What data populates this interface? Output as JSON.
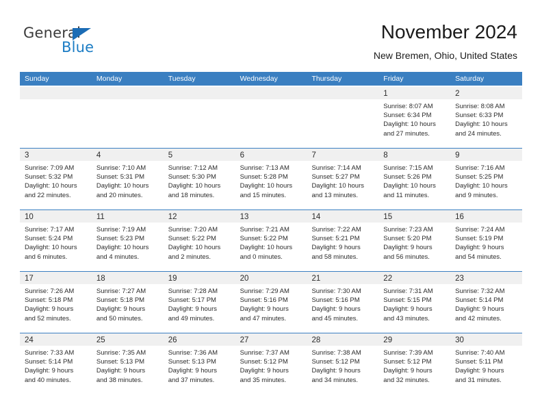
{
  "brand": {
    "name_top": "General",
    "name_bottom": "Blue",
    "triangle_color": "#1b6cb5",
    "blue_text_color": "#1b7cc4"
  },
  "header": {
    "title": "November 2024",
    "subtitle": "New Bremen, Ohio, United States"
  },
  "theme": {
    "header_blue": "#3a7fc1",
    "day_band_gray": "#f0f0f0",
    "text_color": "#2b2b2b"
  },
  "weekdays": [
    "Sunday",
    "Monday",
    "Tuesday",
    "Wednesday",
    "Thursday",
    "Friday",
    "Saturday"
  ],
  "weeks": [
    [
      {
        "empty": true
      },
      {
        "empty": true
      },
      {
        "empty": true
      },
      {
        "empty": true
      },
      {
        "empty": true
      },
      {
        "day": "1",
        "sunrise": "Sunrise: 8:07 AM",
        "sunset": "Sunset: 6:34 PM",
        "daylight1": "Daylight: 10 hours",
        "daylight2": "and 27 minutes."
      },
      {
        "day": "2",
        "sunrise": "Sunrise: 8:08 AM",
        "sunset": "Sunset: 6:33 PM",
        "daylight1": "Daylight: 10 hours",
        "daylight2": "and 24 minutes."
      }
    ],
    [
      {
        "day": "3",
        "sunrise": "Sunrise: 7:09 AM",
        "sunset": "Sunset: 5:32 PM",
        "daylight1": "Daylight: 10 hours",
        "daylight2": "and 22 minutes."
      },
      {
        "day": "4",
        "sunrise": "Sunrise: 7:10 AM",
        "sunset": "Sunset: 5:31 PM",
        "daylight1": "Daylight: 10 hours",
        "daylight2": "and 20 minutes."
      },
      {
        "day": "5",
        "sunrise": "Sunrise: 7:12 AM",
        "sunset": "Sunset: 5:30 PM",
        "daylight1": "Daylight: 10 hours",
        "daylight2": "and 18 minutes."
      },
      {
        "day": "6",
        "sunrise": "Sunrise: 7:13 AM",
        "sunset": "Sunset: 5:28 PM",
        "daylight1": "Daylight: 10 hours",
        "daylight2": "and 15 minutes."
      },
      {
        "day": "7",
        "sunrise": "Sunrise: 7:14 AM",
        "sunset": "Sunset: 5:27 PM",
        "daylight1": "Daylight: 10 hours",
        "daylight2": "and 13 minutes."
      },
      {
        "day": "8",
        "sunrise": "Sunrise: 7:15 AM",
        "sunset": "Sunset: 5:26 PM",
        "daylight1": "Daylight: 10 hours",
        "daylight2": "and 11 minutes."
      },
      {
        "day": "9",
        "sunrise": "Sunrise: 7:16 AM",
        "sunset": "Sunset: 5:25 PM",
        "daylight1": "Daylight: 10 hours",
        "daylight2": "and 9 minutes."
      }
    ],
    [
      {
        "day": "10",
        "sunrise": "Sunrise: 7:17 AM",
        "sunset": "Sunset: 5:24 PM",
        "daylight1": "Daylight: 10 hours",
        "daylight2": "and 6 minutes."
      },
      {
        "day": "11",
        "sunrise": "Sunrise: 7:19 AM",
        "sunset": "Sunset: 5:23 PM",
        "daylight1": "Daylight: 10 hours",
        "daylight2": "and 4 minutes."
      },
      {
        "day": "12",
        "sunrise": "Sunrise: 7:20 AM",
        "sunset": "Sunset: 5:22 PM",
        "daylight1": "Daylight: 10 hours",
        "daylight2": "and 2 minutes."
      },
      {
        "day": "13",
        "sunrise": "Sunrise: 7:21 AM",
        "sunset": "Sunset: 5:22 PM",
        "daylight1": "Daylight: 10 hours",
        "daylight2": "and 0 minutes."
      },
      {
        "day": "14",
        "sunrise": "Sunrise: 7:22 AM",
        "sunset": "Sunset: 5:21 PM",
        "daylight1": "Daylight: 9 hours",
        "daylight2": "and 58 minutes."
      },
      {
        "day": "15",
        "sunrise": "Sunrise: 7:23 AM",
        "sunset": "Sunset: 5:20 PM",
        "daylight1": "Daylight: 9 hours",
        "daylight2": "and 56 minutes."
      },
      {
        "day": "16",
        "sunrise": "Sunrise: 7:24 AM",
        "sunset": "Sunset: 5:19 PM",
        "daylight1": "Daylight: 9 hours",
        "daylight2": "and 54 minutes."
      }
    ],
    [
      {
        "day": "17",
        "sunrise": "Sunrise: 7:26 AM",
        "sunset": "Sunset: 5:18 PM",
        "daylight1": "Daylight: 9 hours",
        "daylight2": "and 52 minutes."
      },
      {
        "day": "18",
        "sunrise": "Sunrise: 7:27 AM",
        "sunset": "Sunset: 5:18 PM",
        "daylight1": "Daylight: 9 hours",
        "daylight2": "and 50 minutes."
      },
      {
        "day": "19",
        "sunrise": "Sunrise: 7:28 AM",
        "sunset": "Sunset: 5:17 PM",
        "daylight1": "Daylight: 9 hours",
        "daylight2": "and 49 minutes."
      },
      {
        "day": "20",
        "sunrise": "Sunrise: 7:29 AM",
        "sunset": "Sunset: 5:16 PM",
        "daylight1": "Daylight: 9 hours",
        "daylight2": "and 47 minutes."
      },
      {
        "day": "21",
        "sunrise": "Sunrise: 7:30 AM",
        "sunset": "Sunset: 5:16 PM",
        "daylight1": "Daylight: 9 hours",
        "daylight2": "and 45 minutes."
      },
      {
        "day": "22",
        "sunrise": "Sunrise: 7:31 AM",
        "sunset": "Sunset: 5:15 PM",
        "daylight1": "Daylight: 9 hours",
        "daylight2": "and 43 minutes."
      },
      {
        "day": "23",
        "sunrise": "Sunrise: 7:32 AM",
        "sunset": "Sunset: 5:14 PM",
        "daylight1": "Daylight: 9 hours",
        "daylight2": "and 42 minutes."
      }
    ],
    [
      {
        "day": "24",
        "sunrise": "Sunrise: 7:33 AM",
        "sunset": "Sunset: 5:14 PM",
        "daylight1": "Daylight: 9 hours",
        "daylight2": "and 40 minutes."
      },
      {
        "day": "25",
        "sunrise": "Sunrise: 7:35 AM",
        "sunset": "Sunset: 5:13 PM",
        "daylight1": "Daylight: 9 hours",
        "daylight2": "and 38 minutes."
      },
      {
        "day": "26",
        "sunrise": "Sunrise: 7:36 AM",
        "sunset": "Sunset: 5:13 PM",
        "daylight1": "Daylight: 9 hours",
        "daylight2": "and 37 minutes."
      },
      {
        "day": "27",
        "sunrise": "Sunrise: 7:37 AM",
        "sunset": "Sunset: 5:12 PM",
        "daylight1": "Daylight: 9 hours",
        "daylight2": "and 35 minutes."
      },
      {
        "day": "28",
        "sunrise": "Sunrise: 7:38 AM",
        "sunset": "Sunset: 5:12 PM",
        "daylight1": "Daylight: 9 hours",
        "daylight2": "and 34 minutes."
      },
      {
        "day": "29",
        "sunrise": "Sunrise: 7:39 AM",
        "sunset": "Sunset: 5:12 PM",
        "daylight1": "Daylight: 9 hours",
        "daylight2": "and 32 minutes."
      },
      {
        "day": "30",
        "sunrise": "Sunrise: 7:40 AM",
        "sunset": "Sunset: 5:11 PM",
        "daylight1": "Daylight: 9 hours",
        "daylight2": "and 31 minutes."
      }
    ]
  ]
}
